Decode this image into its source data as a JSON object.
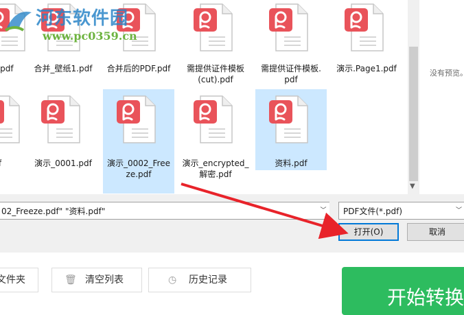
{
  "watermark": {
    "title": "河东软件园",
    "url": "www.pc0359.cn"
  },
  "files": [
    {
      "label": ".pdf",
      "selected": false
    },
    {
      "label": "合并_壁纸1.pdf",
      "selected": false
    },
    {
      "label": "合并后的PDF.pdf",
      "selected": false
    },
    {
      "label": "需提供证件模板(cut).pdf",
      "selected": false
    },
    {
      "label": "需提供证件模板.pdf",
      "selected": false
    },
    {
      "label": "演示.Page1.pdf",
      "selected": false
    },
    {
      "label": "f",
      "selected": false
    },
    {
      "label": "演示_0001.pdf",
      "selected": false
    },
    {
      "label": "演示_0002_Freeze.pdf",
      "selected": true
    },
    {
      "label": "演示_encrypted_解密.pdf",
      "selected": false
    },
    {
      "label": "资料.pdf",
      "selected": true
    }
  ],
  "preview": {
    "text": "没有预览。"
  },
  "filename_field": {
    "value": "02_Freeze.pdf\" \"资料.pdf\""
  },
  "filetype_field": {
    "value": "PDF文件(*.pdf)"
  },
  "buttons": {
    "open": "打开(O)",
    "cancel": "取消"
  },
  "app_toolbar": {
    "add_folder": "文件夹",
    "clear_list": "清空列表",
    "history": "历史记录",
    "start": "开始转换"
  },
  "colors": {
    "pdf_badge": "#e9535a",
    "selection": "#cce8ff",
    "focus_border": "#0078d7",
    "start_button": "#2dbc5f",
    "annotation_arrow": "#e8232a"
  }
}
